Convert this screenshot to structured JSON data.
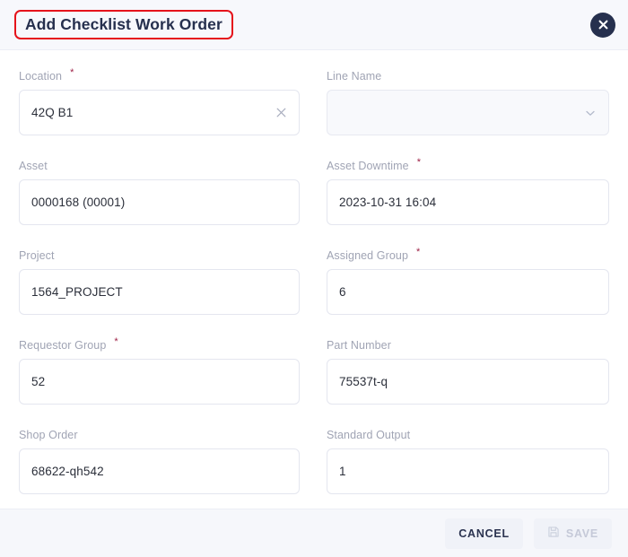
{
  "dialog": {
    "title": "Add Checklist Work Order",
    "close_icon": "close-icon",
    "title_highlight_color": "#e5131b",
    "header_bg": "#f7f8fc",
    "close_bg": "#26304e"
  },
  "form": {
    "fields": [
      {
        "label": "Location",
        "required": true,
        "value": "42Q B1",
        "type": "text-clearable",
        "adornment": "clear-icon",
        "disabled": false,
        "name": "location"
      },
      {
        "label": "Line Name",
        "required": false,
        "value": "",
        "type": "select",
        "adornment": "chevron-down-icon",
        "disabled": true,
        "name": "line-name"
      },
      {
        "label": "Asset",
        "required": false,
        "value": "0000168 (00001)",
        "type": "text",
        "adornment": "",
        "disabled": false,
        "name": "asset"
      },
      {
        "label": "Asset Downtime",
        "required": true,
        "value": "2023-10-31 16:04",
        "type": "text",
        "adornment": "",
        "disabled": false,
        "name": "asset-downtime"
      },
      {
        "label": "Project",
        "required": false,
        "value": "1564_PROJECT",
        "type": "text",
        "adornment": "",
        "disabled": false,
        "name": "project"
      },
      {
        "label": "Assigned Group",
        "required": true,
        "value": "6",
        "type": "text",
        "adornment": "",
        "disabled": false,
        "name": "assigned-group"
      },
      {
        "label": "Requestor Group",
        "required": true,
        "value": "52",
        "type": "text",
        "adornment": "",
        "disabled": false,
        "name": "requestor-group"
      },
      {
        "label": "Part Number",
        "required": false,
        "value": "75537t-q",
        "type": "text",
        "adornment": "",
        "disabled": false,
        "name": "part-number"
      },
      {
        "label": "Shop Order",
        "required": false,
        "value": "68622-qh542",
        "type": "text",
        "adornment": "",
        "disabled": false,
        "name": "shop-order"
      },
      {
        "label": "Standard Output",
        "required": false,
        "value": "1",
        "type": "text",
        "adornment": "",
        "disabled": false,
        "name": "standard-output"
      }
    ],
    "required_marker": "*"
  },
  "footer": {
    "cancel_label": "CANCEL",
    "save_label": "SAVE",
    "save_icon": "save-icon",
    "save_disabled": true
  }
}
